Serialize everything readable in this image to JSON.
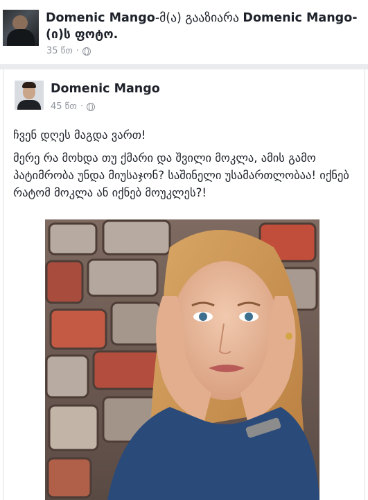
{
  "share": {
    "actor": "Domenic Mango",
    "connector": "-მ(ა) გააზიარა",
    "owner": "Domenic Mango",
    "suffix": "-(ი)ს ფოტო.",
    "time": "35 წთ",
    "privacy_icon": "globe-icon"
  },
  "post": {
    "author": "Domenic Mango",
    "time": "45 წთ",
    "privacy_icon": "globe-icon",
    "line1": "ჩვენ დღეს მაგდა ვართ!",
    "line2": "მერე რა მოხდა თუ ქმარი და შვილი მოკლა, ამის გამო პატიმრობა უნდა მიუსაჯონ? საშინელი უსამართლობაა! იქნებ რატომ მოკლა ან იქნებ მოუკლეს?!"
  },
  "colors": {
    "text": "#1d2129",
    "meta": "#90949c",
    "divider": "#e9ebee",
    "border": "#dddfe2"
  }
}
